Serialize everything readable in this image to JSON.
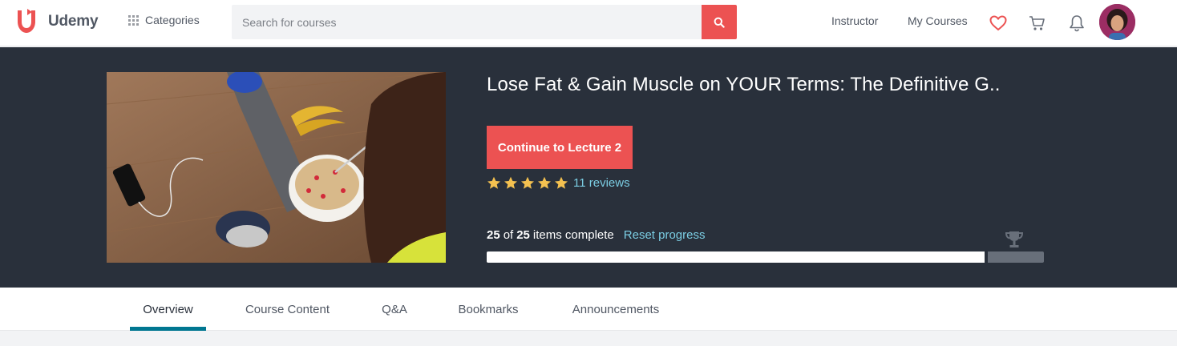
{
  "brand": {
    "name": "Udemy",
    "accent": "#ec5252",
    "link_color": "#7bcde3",
    "tab_active_color": "#007791"
  },
  "header": {
    "categories_label": "Categories",
    "search_placeholder": "Search for courses",
    "instructor_label": "Instructor",
    "my_courses_label": "My Courses",
    "icons": [
      "grid-icon",
      "search-icon",
      "heart-icon",
      "cart-icon",
      "bell-icon",
      "avatar"
    ]
  },
  "course": {
    "title": "Lose Fat & Gain Muscle on YOUR Terms: The Definitive G...",
    "continue_label": "Continue to Lecture 2",
    "rating": 5,
    "reviews_label": "11 reviews",
    "completed": "25",
    "total": "25",
    "of_label": "of",
    "items_complete_label": "items complete",
    "reset_label": "Reset progress",
    "progress_fraction": 0.9
  },
  "tabs": [
    {
      "label": "Overview",
      "active": true
    },
    {
      "label": "Course Content",
      "active": false
    },
    {
      "label": "Q&A",
      "active": false
    },
    {
      "label": "Bookmarks",
      "active": false
    },
    {
      "label": "Announcements",
      "active": false
    }
  ]
}
